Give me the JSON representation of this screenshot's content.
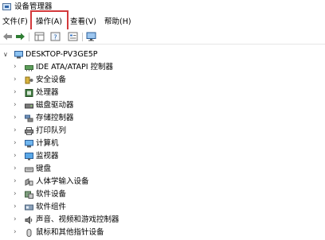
{
  "window": {
    "title": "设备管理器",
    "icon": "device-manager-icon"
  },
  "menu": [
    "文件(F)",
    "操作(A)",
    "查看(V)",
    "帮助(H)"
  ],
  "highlight_color": "#d3393b",
  "toolbar": [
    "back-arrow-icon",
    "forward-arrow-icon",
    "properties-grid-icon",
    "help-icon",
    "details-icon",
    "monitor-scan-icon"
  ],
  "tree": {
    "root": {
      "label": "DESKTOP-PV3GE5P",
      "icon": "computer-icon",
      "expanded": true
    },
    "children": [
      {
        "label": "IDE ATA/ATAPI 控制器",
        "icon": "ide-controller-icon"
      },
      {
        "label": "安全设备",
        "icon": "security-device-icon"
      },
      {
        "label": "处理器",
        "icon": "processor-icon"
      },
      {
        "label": "磁盘驱动器",
        "icon": "disk-drive-icon"
      },
      {
        "label": "存储控制器",
        "icon": "storage-controller-icon"
      },
      {
        "label": "打印队列",
        "icon": "printer-icon"
      },
      {
        "label": "计算机",
        "icon": "computer-icon"
      },
      {
        "label": "监视器",
        "icon": "monitor-icon"
      },
      {
        "label": "键盘",
        "icon": "keyboard-icon"
      },
      {
        "label": "人体学输入设备",
        "icon": "hid-icon"
      },
      {
        "label": "软件设备",
        "icon": "software-device-icon"
      },
      {
        "label": "软件组件",
        "icon": "software-component-icon"
      },
      {
        "label": "声音、视频和游戏控制器",
        "icon": "sound-icon"
      },
      {
        "label": "鼠标和其他指针设备",
        "icon": "mouse-icon"
      }
    ]
  }
}
